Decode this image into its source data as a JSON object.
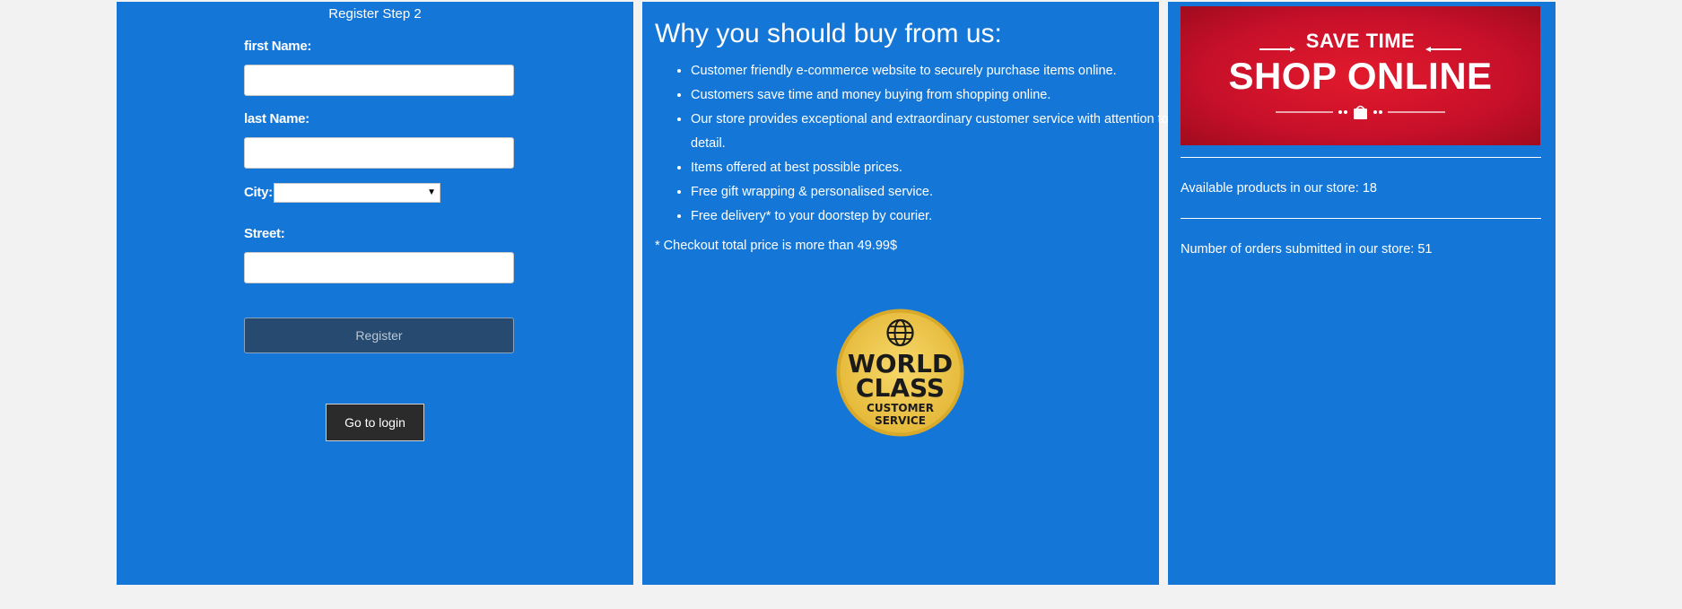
{
  "colors": {
    "panel_bg": "#1477d8",
    "page_bg": "#f2f2f2",
    "register_button_bg": "#274a70",
    "login_button_bg": "#2b2b2b",
    "banner_red": "#c8102a",
    "badge_gold": "#f2c94c"
  },
  "register": {
    "step_title": "Register Step 2",
    "first_name_label": "first Name:",
    "first_name_value": "",
    "last_name_label": "last Name:",
    "last_name_value": "",
    "city_label": "City:",
    "city_selected": "",
    "street_label": "Street:",
    "street_value": "",
    "register_button": "Register",
    "login_button": "Go to login"
  },
  "benefits": {
    "title": "Why you should buy from us:",
    "items": [
      "Customer friendly e-commerce website to securely purchase items online.",
      "Customers save time and money buying from shopping online.",
      "Our store provides exceptional and extraordinary customer service with attention to detail.",
      "Items offered at best possible prices.",
      "Free gift wrapping & personalised service.",
      "Free delivery* to your doorstep by courier."
    ],
    "note": "* Checkout total price is more than 49.99$",
    "badge": {
      "icon": "globe-icon",
      "line1": "WORLD",
      "line2": "CLASS",
      "line3": "CUSTOMER",
      "line4": "SERVICE"
    }
  },
  "store": {
    "banner_line1": "SAVE TIME",
    "banner_line2": "SHOP ONLINE",
    "banner_icons": [
      "clock-icon",
      "shopping-bag-icon"
    ],
    "products_text": "Available products in our store: 18",
    "orders_text": "Number of orders submitted in our store: 51"
  }
}
